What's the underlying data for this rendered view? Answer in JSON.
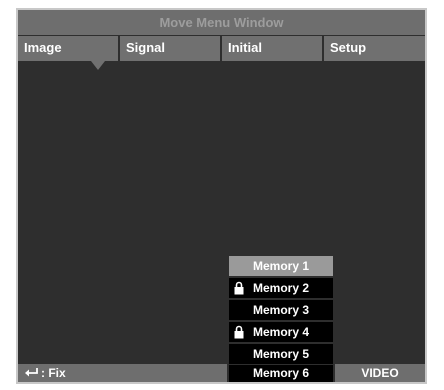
{
  "window": {
    "title": "Move Menu Window"
  },
  "tabs": [
    {
      "label": "Image",
      "selected": true
    },
    {
      "label": "Signal"
    },
    {
      "label": "Initial"
    },
    {
      "label": "Setup"
    }
  ],
  "memories": [
    {
      "label": "Memory 1",
      "locked": false,
      "selected": true
    },
    {
      "label": "Memory 2",
      "locked": true
    },
    {
      "label": "Memory 3",
      "locked": false
    },
    {
      "label": "Memory 4",
      "locked": true
    },
    {
      "label": "Memory 5",
      "locked": false
    },
    {
      "label": "Memory 6",
      "locked": false
    }
  ],
  "footer": {
    "hint_icon": "enter-icon",
    "hint_label": ": Fix",
    "source_label": "VIDEO"
  },
  "colors": {
    "background": "#2e2e2e",
    "bar": "#6e6e6e",
    "tab": "#707070",
    "memory": "#000000",
    "memory_selected": "#9a9a9a",
    "title_text": "#9d9d9d"
  }
}
